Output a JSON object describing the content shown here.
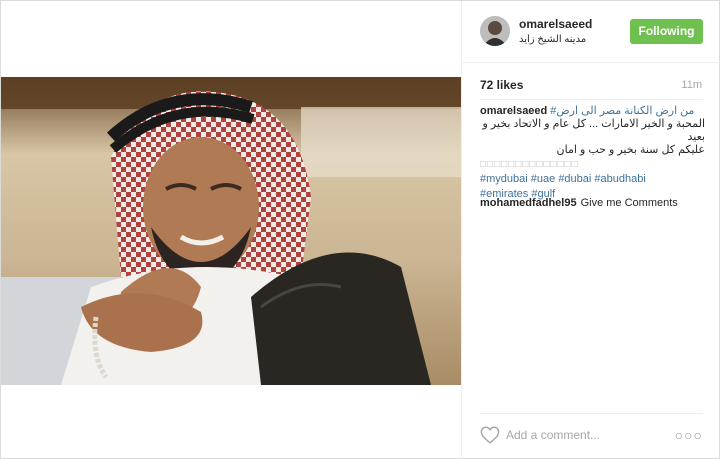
{
  "post": {
    "username": "omarelsaeed",
    "location": "مدينه الشيخ زايد",
    "follow_label": "Following",
    "likes": "72 likes",
    "time_ago": "11m",
    "caption": {
      "username": "omarelsaeed",
      "line1": "من ارض الكنانة مصر الى ارض#",
      "line2": "المحبة و الخير الامارات ... كل عام و الاتحاد بخير و بعيد",
      "line3": "عليكم كل سنة بخير و حب و امان",
      "boxes": "□□□□□□□□□□□□□□",
      "hashtags_line1": [
        "#mydubai",
        "#uae",
        "#dubai",
        "#abudhabi"
      ],
      "hashtags_line2": [
        "#emirates",
        "#gulf"
      ]
    },
    "comments": [
      {
        "username": "mohamedfadhel95",
        "text": "Give me Comments"
      }
    ],
    "add_comment_placeholder": "Add a comment...",
    "more_label": "○○○"
  },
  "colors": {
    "follow_button": "#70c050",
    "hashtag": "#3f729b",
    "muted": "#a5a7aa"
  },
  "icons": {
    "heart": "heart-icon",
    "more": "more-options-icon"
  }
}
